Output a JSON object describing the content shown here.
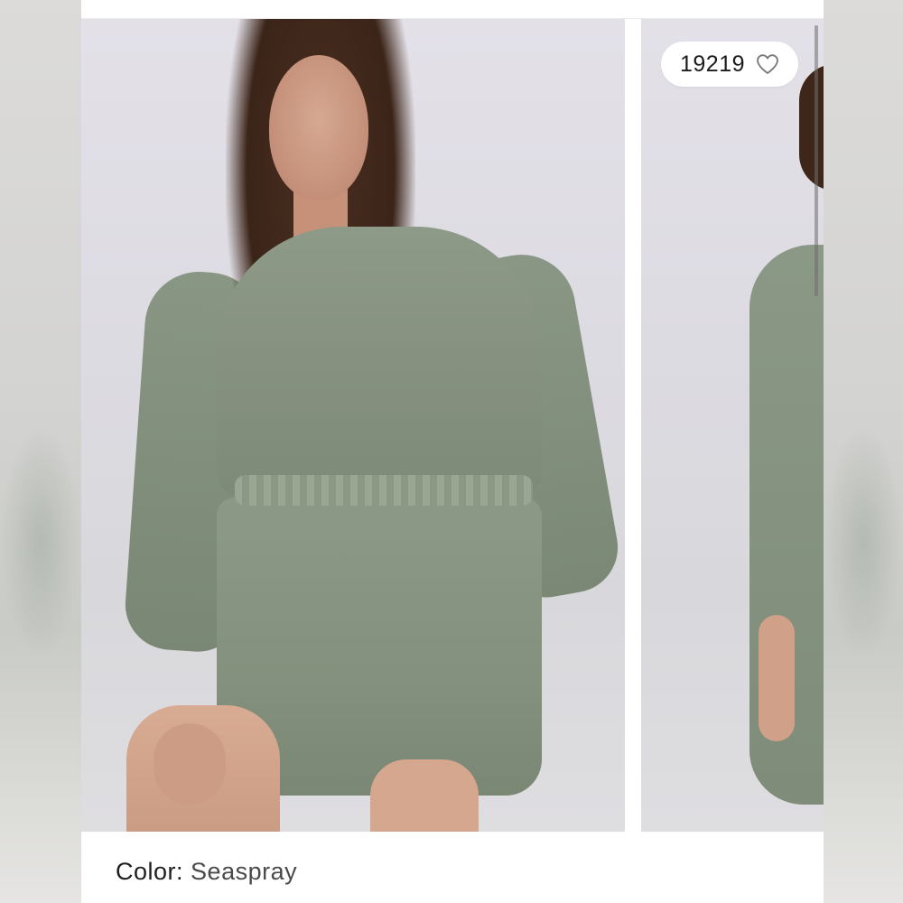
{
  "gallery": {
    "like_count": "19219",
    "like_icon": "heart-outline-icon"
  },
  "product": {
    "color_label": "Color:",
    "color_value": "Seaspray"
  },
  "colors": {
    "dress": "#86927f",
    "background": "#e3e0e8",
    "pill": "#ffffff"
  }
}
